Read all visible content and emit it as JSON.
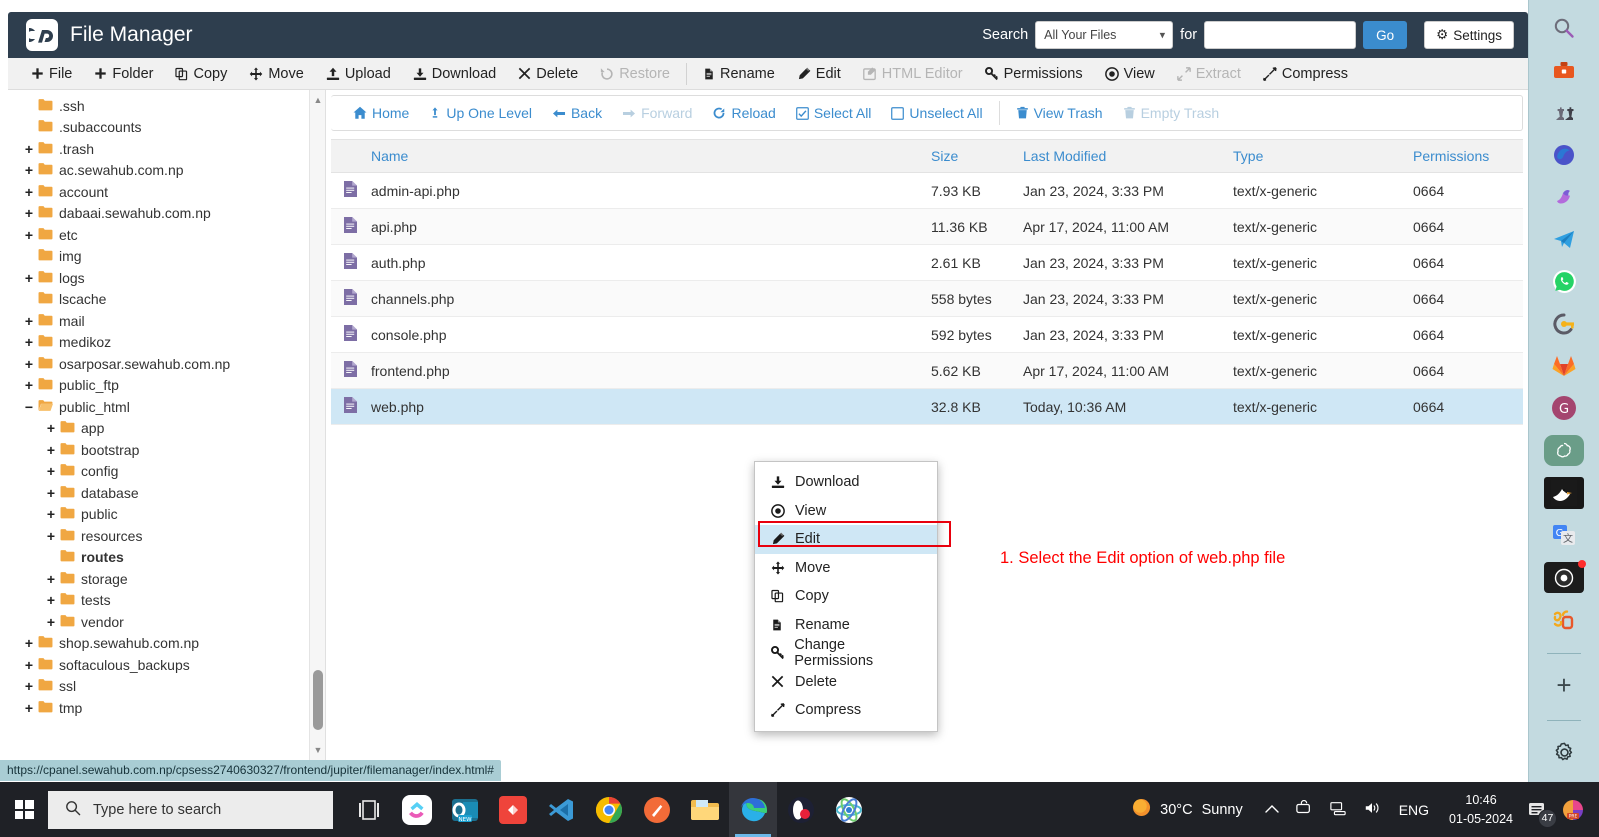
{
  "header": {
    "logo_text": "cP",
    "title": "File Manager",
    "search_label": "Search",
    "search_scope_selected": "All Your Files",
    "search_scope_options": [
      "All Your Files"
    ],
    "for_label": "for",
    "search_value": "",
    "search_placeholder": "",
    "go_label": "Go",
    "settings_label": "Settings"
  },
  "toolbar": [
    {
      "label": "File",
      "icon": "plus-icon",
      "disabled": false
    },
    {
      "label": "Folder",
      "icon": "plus-icon",
      "disabled": false
    },
    {
      "label": "Copy",
      "icon": "copy-icon",
      "disabled": false
    },
    {
      "label": "Move",
      "icon": "move-icon",
      "disabled": false
    },
    {
      "label": "Upload",
      "icon": "upload-icon",
      "disabled": false
    },
    {
      "label": "Download",
      "icon": "download-icon",
      "disabled": false
    },
    {
      "label": "Delete",
      "icon": "delete-icon",
      "disabled": false
    },
    {
      "label": "Restore",
      "icon": "restore-icon",
      "disabled": true
    },
    {
      "label": "Rename",
      "icon": "rename-icon",
      "disabled": false
    },
    {
      "label": "Edit",
      "icon": "edit-icon",
      "disabled": false
    },
    {
      "label": "HTML Editor",
      "icon": "html-editor-icon",
      "disabled": true
    },
    {
      "label": "Permissions",
      "icon": "key-icon",
      "disabled": false
    },
    {
      "label": "View",
      "icon": "eye-icon",
      "disabled": false
    },
    {
      "label": "Extract",
      "icon": "extract-icon",
      "disabled": true
    },
    {
      "label": "Compress",
      "icon": "compress-icon",
      "disabled": false
    }
  ],
  "path_toolbar": [
    {
      "label": "Home",
      "icon": "home-icon",
      "disabled": false
    },
    {
      "label": "Up One Level",
      "icon": "up-arrow-icon",
      "disabled": false
    },
    {
      "label": "Back",
      "icon": "left-arrow-icon",
      "disabled": false
    },
    {
      "label": "Forward",
      "icon": "right-arrow-icon",
      "disabled": true
    },
    {
      "label": "Reload",
      "icon": "reload-icon",
      "disabled": false
    },
    {
      "label": "Select All",
      "icon": "checked-box-icon",
      "disabled": false
    },
    {
      "label": "Unselect All",
      "icon": "empty-box-icon",
      "disabled": false
    },
    {
      "label": "View Trash",
      "icon": "trash-icon",
      "disabled": false
    },
    {
      "label": "Empty Trash",
      "icon": "trash-icon",
      "disabled": true
    }
  ],
  "tree": [
    {
      "label": ".ssh",
      "indent": 1,
      "toggle": "",
      "open": false,
      "bold": false
    },
    {
      "label": ".subaccounts",
      "indent": 1,
      "toggle": "",
      "open": false,
      "bold": false
    },
    {
      "label": ".trash",
      "indent": 1,
      "toggle": "+",
      "open": false,
      "bold": false
    },
    {
      "label": "ac.sewahub.com.np",
      "indent": 1,
      "toggle": "+",
      "open": false,
      "bold": false
    },
    {
      "label": "account",
      "indent": 1,
      "toggle": "+",
      "open": false,
      "bold": false
    },
    {
      "label": "dabaai.sewahub.com.np",
      "indent": 1,
      "toggle": "+",
      "open": false,
      "bold": false
    },
    {
      "label": "etc",
      "indent": 1,
      "toggle": "+",
      "open": false,
      "bold": false
    },
    {
      "label": "img",
      "indent": 1,
      "toggle": "",
      "open": false,
      "bold": false
    },
    {
      "label": "logs",
      "indent": 1,
      "toggle": "+",
      "open": false,
      "bold": false
    },
    {
      "label": "lscache",
      "indent": 1,
      "toggle": "",
      "open": false,
      "bold": false
    },
    {
      "label": "mail",
      "indent": 1,
      "toggle": "+",
      "open": false,
      "bold": false
    },
    {
      "label": "medikoz",
      "indent": 1,
      "toggle": "+",
      "open": false,
      "bold": false
    },
    {
      "label": "osarposar.sewahub.com.np",
      "indent": 1,
      "toggle": "+",
      "open": false,
      "bold": false
    },
    {
      "label": "public_ftp",
      "indent": 1,
      "toggle": "+",
      "open": false,
      "bold": false
    },
    {
      "label": "public_html",
      "indent": 1,
      "toggle": "−",
      "open": true,
      "bold": false
    },
    {
      "label": "app",
      "indent": 2,
      "toggle": "+",
      "open": false,
      "bold": false
    },
    {
      "label": "bootstrap",
      "indent": 2,
      "toggle": "+",
      "open": false,
      "bold": false
    },
    {
      "label": "config",
      "indent": 2,
      "toggle": "+",
      "open": false,
      "bold": false
    },
    {
      "label": "database",
      "indent": 2,
      "toggle": "+",
      "open": false,
      "bold": false
    },
    {
      "label": "public",
      "indent": 2,
      "toggle": "+",
      "open": false,
      "bold": false
    },
    {
      "label": "resources",
      "indent": 2,
      "toggle": "+",
      "open": false,
      "bold": false
    },
    {
      "label": "routes",
      "indent": 2,
      "toggle": "",
      "open": false,
      "bold": true
    },
    {
      "label": "storage",
      "indent": 2,
      "toggle": "+",
      "open": false,
      "bold": false
    },
    {
      "label": "tests",
      "indent": 2,
      "toggle": "+",
      "open": false,
      "bold": false
    },
    {
      "label": "vendor",
      "indent": 2,
      "toggle": "+",
      "open": false,
      "bold": false
    },
    {
      "label": "shop.sewahub.com.np",
      "indent": 1,
      "toggle": "+",
      "open": false,
      "bold": false
    },
    {
      "label": "softaculous_backups",
      "indent": 1,
      "toggle": "+",
      "open": false,
      "bold": false
    },
    {
      "label": "ssl",
      "indent": 1,
      "toggle": "+",
      "open": false,
      "bold": false
    },
    {
      "label": "tmp",
      "indent": 1,
      "toggle": "+",
      "open": false,
      "bold": false
    }
  ],
  "table": {
    "columns": [
      "Name",
      "Size",
      "Last Modified",
      "Type",
      "Permissions"
    ],
    "rows": [
      {
        "name": "admin-api.php",
        "size": "7.93 KB",
        "modified": "Jan 23, 2024, 3:33 PM",
        "type": "text/x-generic",
        "permissions": "0664",
        "selected": false
      },
      {
        "name": "api.php",
        "size": "11.36 KB",
        "modified": "Apr 17, 2024, 11:00 AM",
        "type": "text/x-generic",
        "permissions": "0664",
        "selected": false
      },
      {
        "name": "auth.php",
        "size": "2.61 KB",
        "modified": "Jan 23, 2024, 3:33 PM",
        "type": "text/x-generic",
        "permissions": "0664",
        "selected": false
      },
      {
        "name": "channels.php",
        "size": "558 bytes",
        "modified": "Jan 23, 2024, 3:33 PM",
        "type": "text/x-generic",
        "permissions": "0664",
        "selected": false
      },
      {
        "name": "console.php",
        "size": "592 bytes",
        "modified": "Jan 23, 2024, 3:33 PM",
        "type": "text/x-generic",
        "permissions": "0664",
        "selected": false
      },
      {
        "name": "frontend.php",
        "size": "5.62 KB",
        "modified": "Apr 17, 2024, 11:00 AM",
        "type": "text/x-generic",
        "permissions": "0664",
        "selected": false
      },
      {
        "name": "web.php",
        "size": "32.8 KB",
        "modified": "Today, 10:36 AM",
        "type": "text/x-generic",
        "permissions": "0664",
        "selected": true
      }
    ]
  },
  "context_menu": {
    "items": [
      {
        "label": "Download",
        "icon": "download-icon",
        "active": false
      },
      {
        "label": "View",
        "icon": "eye-icon",
        "active": false
      },
      {
        "label": "Edit",
        "icon": "pencil-icon",
        "active": true
      },
      {
        "label": "Move",
        "icon": "move-icon",
        "active": false
      },
      {
        "label": "Copy",
        "icon": "copy-icon",
        "active": false
      },
      {
        "label": "Rename",
        "icon": "rename-icon",
        "active": false
      },
      {
        "label": "Change Permissions",
        "icon": "key-icon",
        "active": false
      },
      {
        "label": "Delete",
        "icon": "delete-icon",
        "active": false
      },
      {
        "label": "Compress",
        "icon": "compress-icon",
        "active": false
      }
    ]
  },
  "annotation": {
    "text": "1. Select the Edit option of web.php file",
    "color": "#ff0000",
    "highlight_color": "#e8000d"
  },
  "status_bar": {
    "url": "https://cpanel.sewahub.com.np/cpsess2740630327/frontend/jupiter/filemanager/index.html#"
  },
  "ext_sidebar": {
    "items": [
      {
        "name": "search-icon"
      },
      {
        "name": "toolbox-icon"
      },
      {
        "name": "chess-icon"
      },
      {
        "name": "microsoft-365-icon"
      },
      {
        "name": "copilot-icon"
      },
      {
        "name": "telegram-icon"
      },
      {
        "name": "whatsapp-icon"
      },
      {
        "name": "password-manager-icon"
      },
      {
        "name": "gitlab-icon"
      },
      {
        "name": "grammarly-icon"
      },
      {
        "name": "chatgpt-icon"
      },
      {
        "name": "seagull-icon"
      },
      {
        "name": "google-translate-icon"
      },
      {
        "name": "screen-recorder-icon"
      },
      {
        "name": "gold-icon"
      },
      {
        "name": "add-extension-icon"
      },
      {
        "name": "settings-gear-icon"
      }
    ]
  },
  "taskbar": {
    "start_label": "Start",
    "search_placeholder": "Type here to search",
    "task_view": "task-view-icon",
    "apps": [
      {
        "name": "clickup-icon",
        "active": false
      },
      {
        "name": "outlook-icon",
        "active": false
      },
      {
        "name": "anydesk-icon",
        "active": false
      },
      {
        "name": "vscode-icon",
        "active": false
      },
      {
        "name": "chrome-icon",
        "active": false
      },
      {
        "name": "firefox-dev-icon",
        "active": false
      },
      {
        "name": "file-explorer-icon",
        "active": false
      },
      {
        "name": "edge-icon",
        "active": true
      },
      {
        "name": "opera-gx-icon",
        "active": false
      },
      {
        "name": "atom-icon",
        "active": false
      }
    ],
    "tray": {
      "weather_temp": "30°C",
      "weather_desc": "Sunny",
      "chevron": "show-hidden-icons",
      "language": "ENG",
      "time": "10:46",
      "date": "01-05-2024",
      "notification_count": "47"
    }
  },
  "colors": {
    "header_bg": "#2e3e4e",
    "accent_blue": "#3b8cce",
    "selected_row": "#cfe7f5",
    "folder_orange": "#f0a742",
    "file_purple": "#7d6ea5",
    "status_bar_bg": "#a9cdd4",
    "taskbar_bg": "#1f2126",
    "ext_sidebar_bg": "#c3dae0"
  }
}
